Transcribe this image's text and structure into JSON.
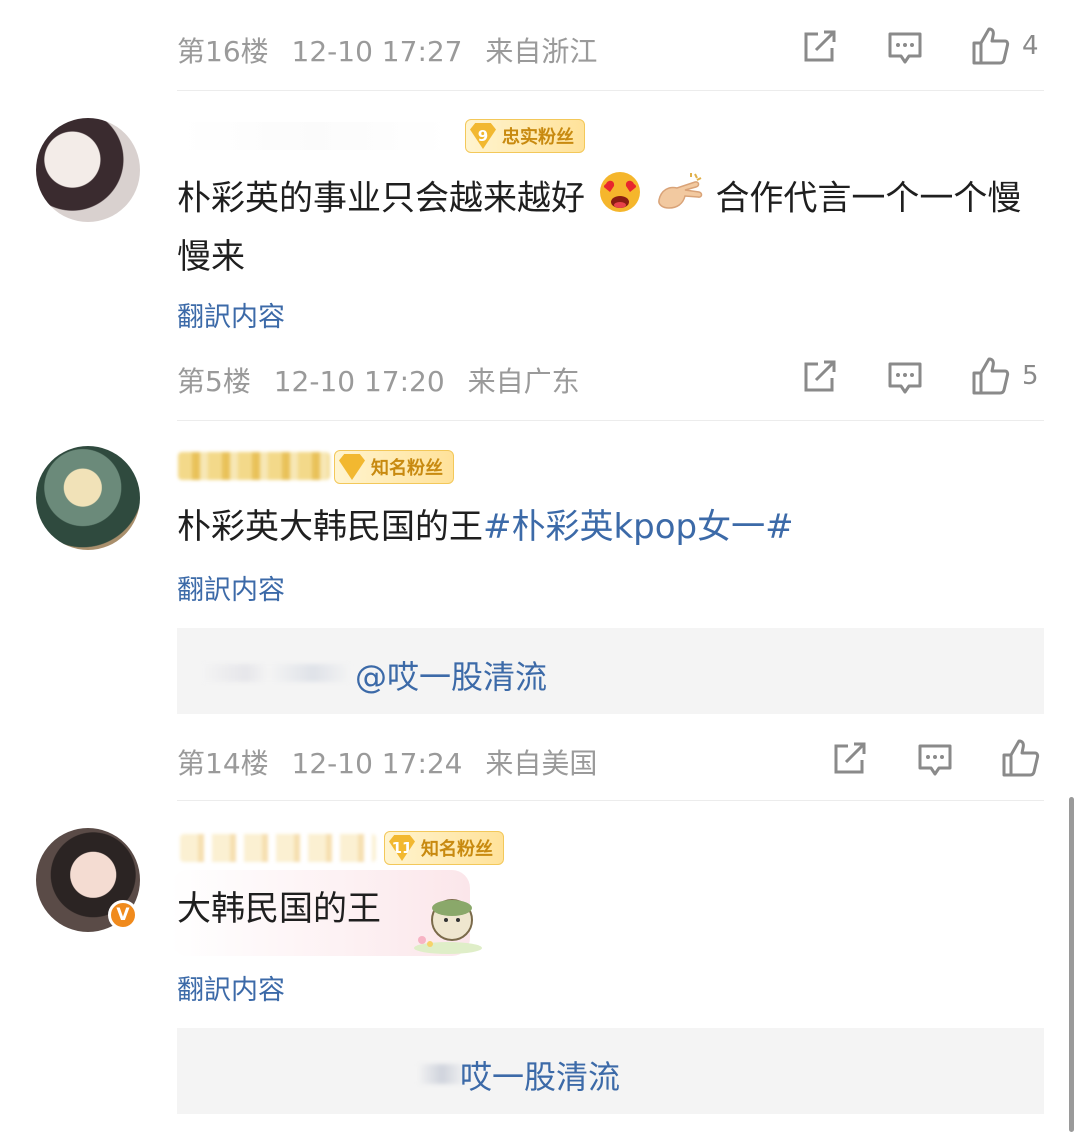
{
  "comments": [
    {
      "meta": {
        "floor": "第16楼",
        "time": "12-10 17:27",
        "location": "来自浙江"
      },
      "like_count": "4"
    },
    {
      "badge": {
        "level": "9",
        "label": "忠实粉丝"
      },
      "text_1": "朴彩英的事业只会越来越好",
      "text_2": "合作代言一个一个慢",
      "text_3": "慢来",
      "translate": "翻訳内容",
      "meta": {
        "floor": "第5楼",
        "time": "12-10 17:20",
        "location": "来自广东"
      },
      "like_count": "5"
    },
    {
      "badge": {
        "level": "",
        "label": "知名粉丝"
      },
      "text": "朴彩英大韩民国的王",
      "hashtag": "#朴彩英kpop女一#",
      "translate": "翻訳内容",
      "reply_mention": "@哎一股清流",
      "meta": {
        "floor": "第14楼",
        "time": "12-10 17:24",
        "location": "来自美国"
      }
    },
    {
      "badge": {
        "level": "11",
        "label": "知名粉丝"
      },
      "verified": "V",
      "text": "大韩民国的王",
      "translate": "翻訳内容",
      "reply_mention": "哎一股清流"
    }
  ],
  "colors": {
    "link": "#3c6aa8",
    "meta": "#9a9a9a",
    "badge_text": "#c88a10"
  },
  "icons": [
    "share-icon",
    "comment-icon",
    "like-icon"
  ]
}
